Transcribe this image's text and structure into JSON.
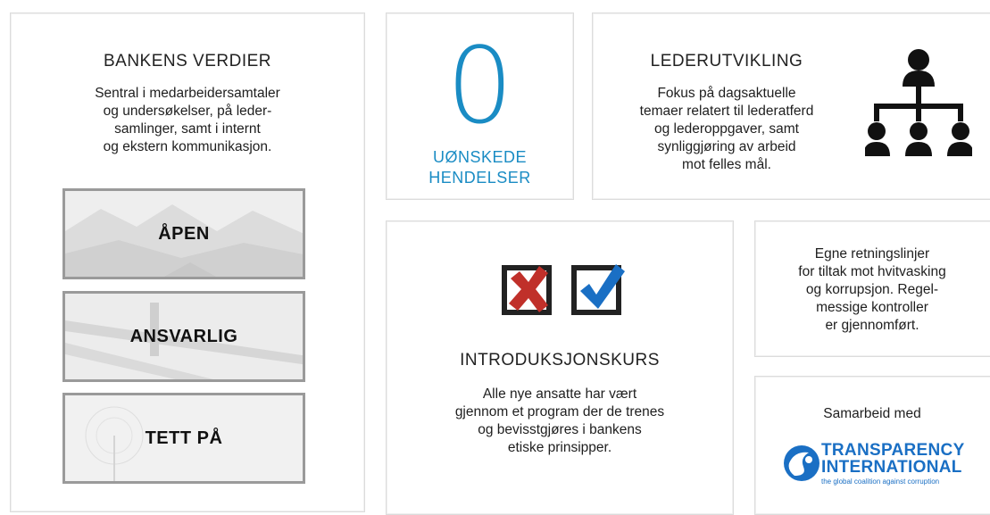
{
  "values_card": {
    "title": "BANKENS VERDIER",
    "body": [
      "Sentral i medarbeidersamtaler",
      "og undersøkelser, på leder-",
      "samlinger, samt i internt",
      "og ekstern kommunikasjon."
    ],
    "tiles": [
      "ÅPEN",
      "ANSVARLIG",
      "TETT PÅ"
    ]
  },
  "incidents_card": {
    "number": "0",
    "label_lines": [
      "UØNSKEDE",
      "HENDELSER"
    ]
  },
  "leadership_card": {
    "title": "LEDERUTVIKLING",
    "body": [
      "Fokus på dagsaktuelle",
      "temaer relatert til lederatferd",
      "og lederoppgaver, samt",
      "synliggjøring av arbeid",
      "mot felles mål."
    ],
    "icon": "org-chart-icon"
  },
  "intro_card": {
    "title": "INTRODUKSJONSKURS",
    "body": [
      "Alle nye ansatte har vært",
      "gjennom et program der de trenes",
      "og bevisstgjøres i bankens",
      "etiske prinsipper."
    ],
    "icons": [
      "checkbox-cross-icon",
      "checkbox-check-icon"
    ]
  },
  "aml_card": {
    "body": [
      "Egne retningslinjer",
      "for tiltak mot hvitvasking",
      "og korrupsjon. Regel-",
      "messige kontroller",
      "er gjennomført."
    ]
  },
  "partner_card": {
    "label": "Samarbeid med",
    "logo_line1": "TRANSPARENCY",
    "logo_line2": "INTERNATIONAL",
    "logo_tagline": "the global coalition against corruption"
  },
  "colors": {
    "accent_blue": "#1a8cc4",
    "cross_red": "#c0302a",
    "check_blue": "#1a6fc4",
    "dark": "#1e1e1e"
  }
}
